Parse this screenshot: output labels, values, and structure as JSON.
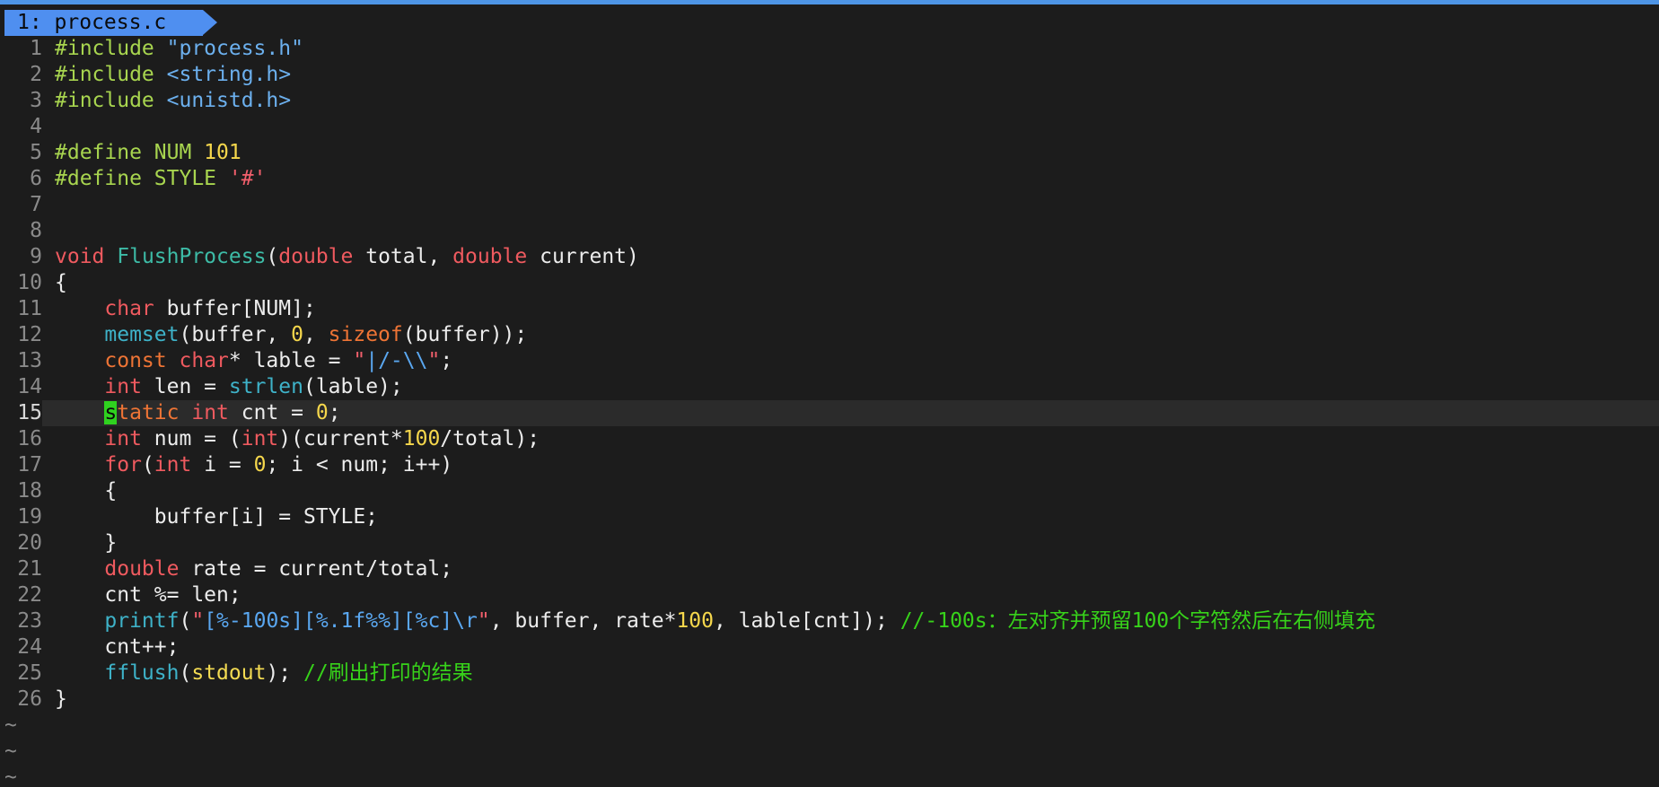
{
  "window": {
    "tab_label": "1: process.c"
  },
  "editor": {
    "current_line": 15,
    "lines": [
      {
        "n": "1",
        "tokens": [
          [
            "pp",
            "#include "
          ],
          [
            "inc",
            "\"process.h\""
          ]
        ]
      },
      {
        "n": "2",
        "tokens": [
          [
            "pp",
            "#include "
          ],
          [
            "inc",
            "<string.h>"
          ]
        ]
      },
      {
        "n": "3",
        "tokens": [
          [
            "pp",
            "#include "
          ],
          [
            "inc",
            "<unistd.h>"
          ]
        ]
      },
      {
        "n": "4",
        "tokens": []
      },
      {
        "n": "5",
        "tokens": [
          [
            "pp",
            "#define NUM "
          ],
          [
            "num",
            "101"
          ]
        ]
      },
      {
        "n": "6",
        "tokens": [
          [
            "pp",
            "#define STYLE "
          ],
          [
            "str",
            "'#'"
          ]
        ]
      },
      {
        "n": "7",
        "tokens": []
      },
      {
        "n": "8",
        "tokens": []
      },
      {
        "n": "9",
        "tokens": [
          [
            "kw",
            "void "
          ],
          [
            "fn",
            "FlushProcess"
          ],
          [
            "dflt",
            "("
          ],
          [
            "kw",
            "double"
          ],
          [
            "dflt",
            " total, "
          ],
          [
            "kw",
            "double"
          ],
          [
            "dflt",
            " current)"
          ]
        ]
      },
      {
        "n": "10",
        "tokens": [
          [
            "dflt",
            "{"
          ]
        ]
      },
      {
        "n": "11",
        "tokens": [
          [
            "dflt",
            "    "
          ],
          [
            "kw",
            "char"
          ],
          [
            "dflt",
            " buffer[NUM];"
          ]
        ]
      },
      {
        "n": "12",
        "tokens": [
          [
            "dflt",
            "    "
          ],
          [
            "fn2",
            "memset"
          ],
          [
            "dflt",
            "(buffer, "
          ],
          [
            "num",
            "0"
          ],
          [
            "dflt",
            ", "
          ],
          [
            "kw2",
            "sizeof"
          ],
          [
            "dflt",
            "(buffer));"
          ]
        ]
      },
      {
        "n": "13",
        "tokens": [
          [
            "dflt",
            "    "
          ],
          [
            "kw2",
            "const"
          ],
          [
            "dflt",
            " "
          ],
          [
            "kw",
            "char"
          ],
          [
            "dflt",
            "* lable = "
          ],
          [
            "str",
            "\""
          ],
          [
            "esc",
            "|/-\\\\"
          ],
          [
            "str",
            "\""
          ],
          [
            "dflt",
            ";"
          ]
        ]
      },
      {
        "n": "14",
        "tokens": [
          [
            "dflt",
            "    "
          ],
          [
            "kw",
            "int"
          ],
          [
            "dflt",
            " len = "
          ],
          [
            "fn2",
            "strlen"
          ],
          [
            "dflt",
            "(lable);"
          ]
        ]
      },
      {
        "n": "15",
        "tokens": [
          [
            "dflt",
            "    "
          ],
          [
            "cursor",
            "s"
          ],
          [
            "kw2",
            "tatic"
          ],
          [
            "dflt",
            " "
          ],
          [
            "kw",
            "int"
          ],
          [
            "dflt",
            " cnt = "
          ],
          [
            "num",
            "0"
          ],
          [
            "dflt",
            ";"
          ]
        ]
      },
      {
        "n": "16",
        "tokens": [
          [
            "dflt",
            "    "
          ],
          [
            "kw",
            "int"
          ],
          [
            "dflt",
            " num = ("
          ],
          [
            "kw",
            "int"
          ],
          [
            "dflt",
            ")(current*"
          ],
          [
            "num",
            "100"
          ],
          [
            "dflt",
            "/total);"
          ]
        ]
      },
      {
        "n": "17",
        "tokens": [
          [
            "dflt",
            "    "
          ],
          [
            "kw",
            "for"
          ],
          [
            "dflt",
            "("
          ],
          [
            "kw",
            "int"
          ],
          [
            "dflt",
            " i = "
          ],
          [
            "num",
            "0"
          ],
          [
            "dflt",
            "; i < num; i++)"
          ]
        ]
      },
      {
        "n": "18",
        "tokens": [
          [
            "dflt",
            "    {"
          ]
        ]
      },
      {
        "n": "19",
        "tokens": [
          [
            "dflt",
            "        buffer[i] = STYLE;"
          ]
        ]
      },
      {
        "n": "20",
        "tokens": [
          [
            "dflt",
            "    }"
          ]
        ]
      },
      {
        "n": "21",
        "tokens": [
          [
            "dflt",
            "    "
          ],
          [
            "kw",
            "double"
          ],
          [
            "dflt",
            " rate = current/total;"
          ]
        ]
      },
      {
        "n": "22",
        "tokens": [
          [
            "dflt",
            "    cnt %= len;"
          ]
        ]
      },
      {
        "n": "23",
        "tokens": [
          [
            "dflt",
            "    "
          ],
          [
            "fn2",
            "printf"
          ],
          [
            "dflt",
            "("
          ],
          [
            "str",
            "\""
          ],
          [
            "esc",
            "[%-100s][%.1f%%][%c]\\r"
          ],
          [
            "str",
            "\""
          ],
          [
            "dflt",
            ", buffer, rate*"
          ],
          [
            "num",
            "100"
          ],
          [
            "dflt",
            ", lable[cnt]); "
          ],
          [
            "cmt",
            "//-100s：左对齐并预留100个字符然后在右侧填充"
          ]
        ]
      },
      {
        "n": "24",
        "tokens": [
          [
            "dflt",
            "    cnt++;"
          ]
        ]
      },
      {
        "n": "25",
        "tokens": [
          [
            "dflt",
            "    "
          ],
          [
            "fn2",
            "fflush"
          ],
          [
            "dflt",
            "("
          ],
          [
            "ylw",
            "stdout"
          ],
          [
            "dflt",
            "); "
          ],
          [
            "cmt",
            "//刷出打印的结果"
          ]
        ]
      },
      {
        "n": "26",
        "tokens": [
          [
            "dflt",
            "}"
          ]
        ]
      }
    ],
    "empty_markers": [
      "~",
      "~",
      "~"
    ]
  },
  "colors": {
    "background": "#1c1c1c",
    "tab": "#4f8ff0",
    "cursor": "#2fd21f",
    "comment": "#37d21a"
  }
}
